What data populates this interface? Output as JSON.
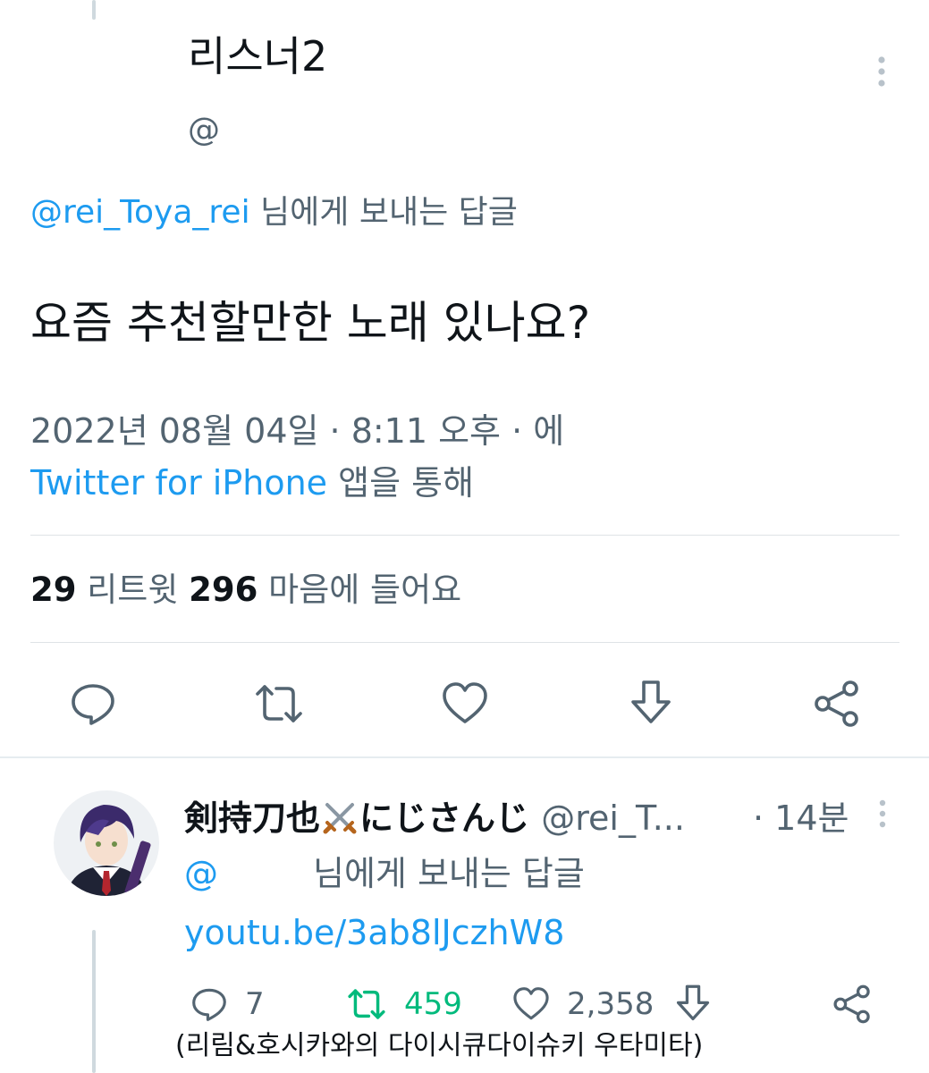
{
  "tweet": {
    "author_name": "리스너2",
    "author_handle": "@",
    "replying_link": "@rei_Toya_rei",
    "replying_suffix": " 님에게 보내는 답글",
    "text": "요즘 추천할만한 노래 있나요?",
    "timestamp": "2022년 08월 04일 · 8:11 오후 · 에",
    "source_app": "Twitter for iPhone",
    "source_suffix": " 앱을 통해",
    "retweets_count": "29",
    "retweets_label": "리트윗",
    "likes_count": "296",
    "likes_label": "마음에 들어요"
  },
  "actions": {
    "icons": [
      "reply-icon",
      "retweet-icon",
      "like-icon",
      "bookmark-icon",
      "share-icon"
    ]
  },
  "reply": {
    "author_name": "剣持刀也",
    "name_emoji": "crossed-swords-icon",
    "author_name_suffix": "にじさんじ",
    "author_handle": "@rei_T...",
    "time": "· 14분",
    "replying_link": "@",
    "replying_suffix": "님에게 보내는 답글",
    "link": "youtu.be/3ab8lJczhW8",
    "reply_count": "7",
    "retweet_count": "459",
    "like_count": "2,358"
  },
  "caption": "(리림&호시카와의 다이시큐다이슈키 우타미타)",
  "colors": {
    "link": "#1d9bf0",
    "secondary_text": "#536471",
    "retweet_active": "#00ba7c"
  }
}
